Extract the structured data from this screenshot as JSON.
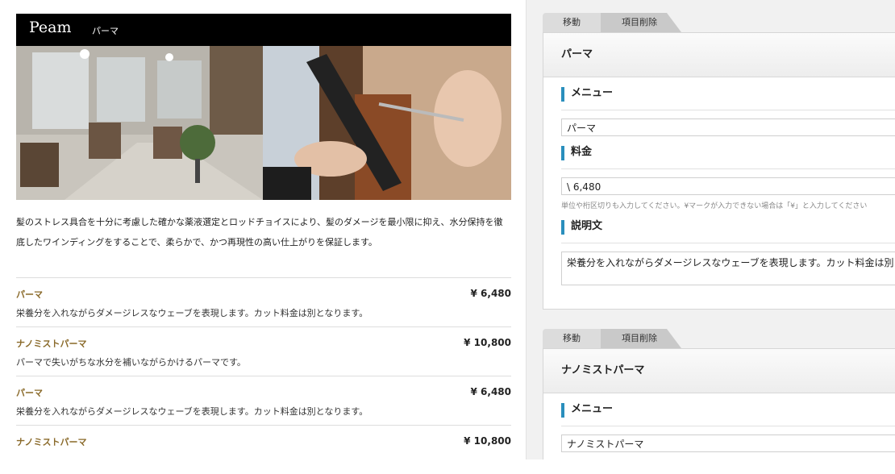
{
  "preview": {
    "brand": "Peam",
    "category": "パーマ",
    "description_line1": "髪のストレス具合を十分に考慮した確かな薬液選定とロッドチョイスにより、髪のダメージを最小限に抑え、水分保持を徹",
    "description_line2": "底したワインディングをすることで、柔らかで、かつ再現性の高い仕上がりを保証します。",
    "items": [
      {
        "name": "パーマ",
        "price": "¥ 6,480",
        "desc": "栄養分を入れながらダメージレスなウェーブを表現します。カット料金は別となります。"
      },
      {
        "name": "ナノミストパーマ",
        "price": "¥ 10,800",
        "desc": "パーマで失いがちな水分を補いながらかけるパーマです。"
      },
      {
        "name": "パーマ",
        "price": "¥ 6,480",
        "desc": "栄養分を入れながらダメージレスなウェーブを表現します。カット料金は別となります。"
      },
      {
        "name": "ナノミストパーマ",
        "price": "¥ 10,800",
        "desc": ""
      }
    ]
  },
  "editor": {
    "tab_move": "移動",
    "tab_delete": "項目削除",
    "cards": [
      {
        "title": "パーマ",
        "menu_label": "メニュー",
        "menu_value": "パーマ",
        "price_label": "料金",
        "price_value": "\\ 6,480",
        "price_hint": "単位や桁区切りも入力してください。¥マークが入力できない場合は「¥」と入力してください",
        "desc_label": "説明文",
        "desc_value": "栄養分を入れながらダメージレスなウェーブを表現します。カット料金は別となります。"
      },
      {
        "title": "ナノミストパーマ",
        "menu_label": "メニュー",
        "menu_value": "ナノミストパーマ"
      }
    ]
  },
  "colors": {
    "accent_bar": "#2a8fbd",
    "item_name": "#8a6a2a"
  }
}
